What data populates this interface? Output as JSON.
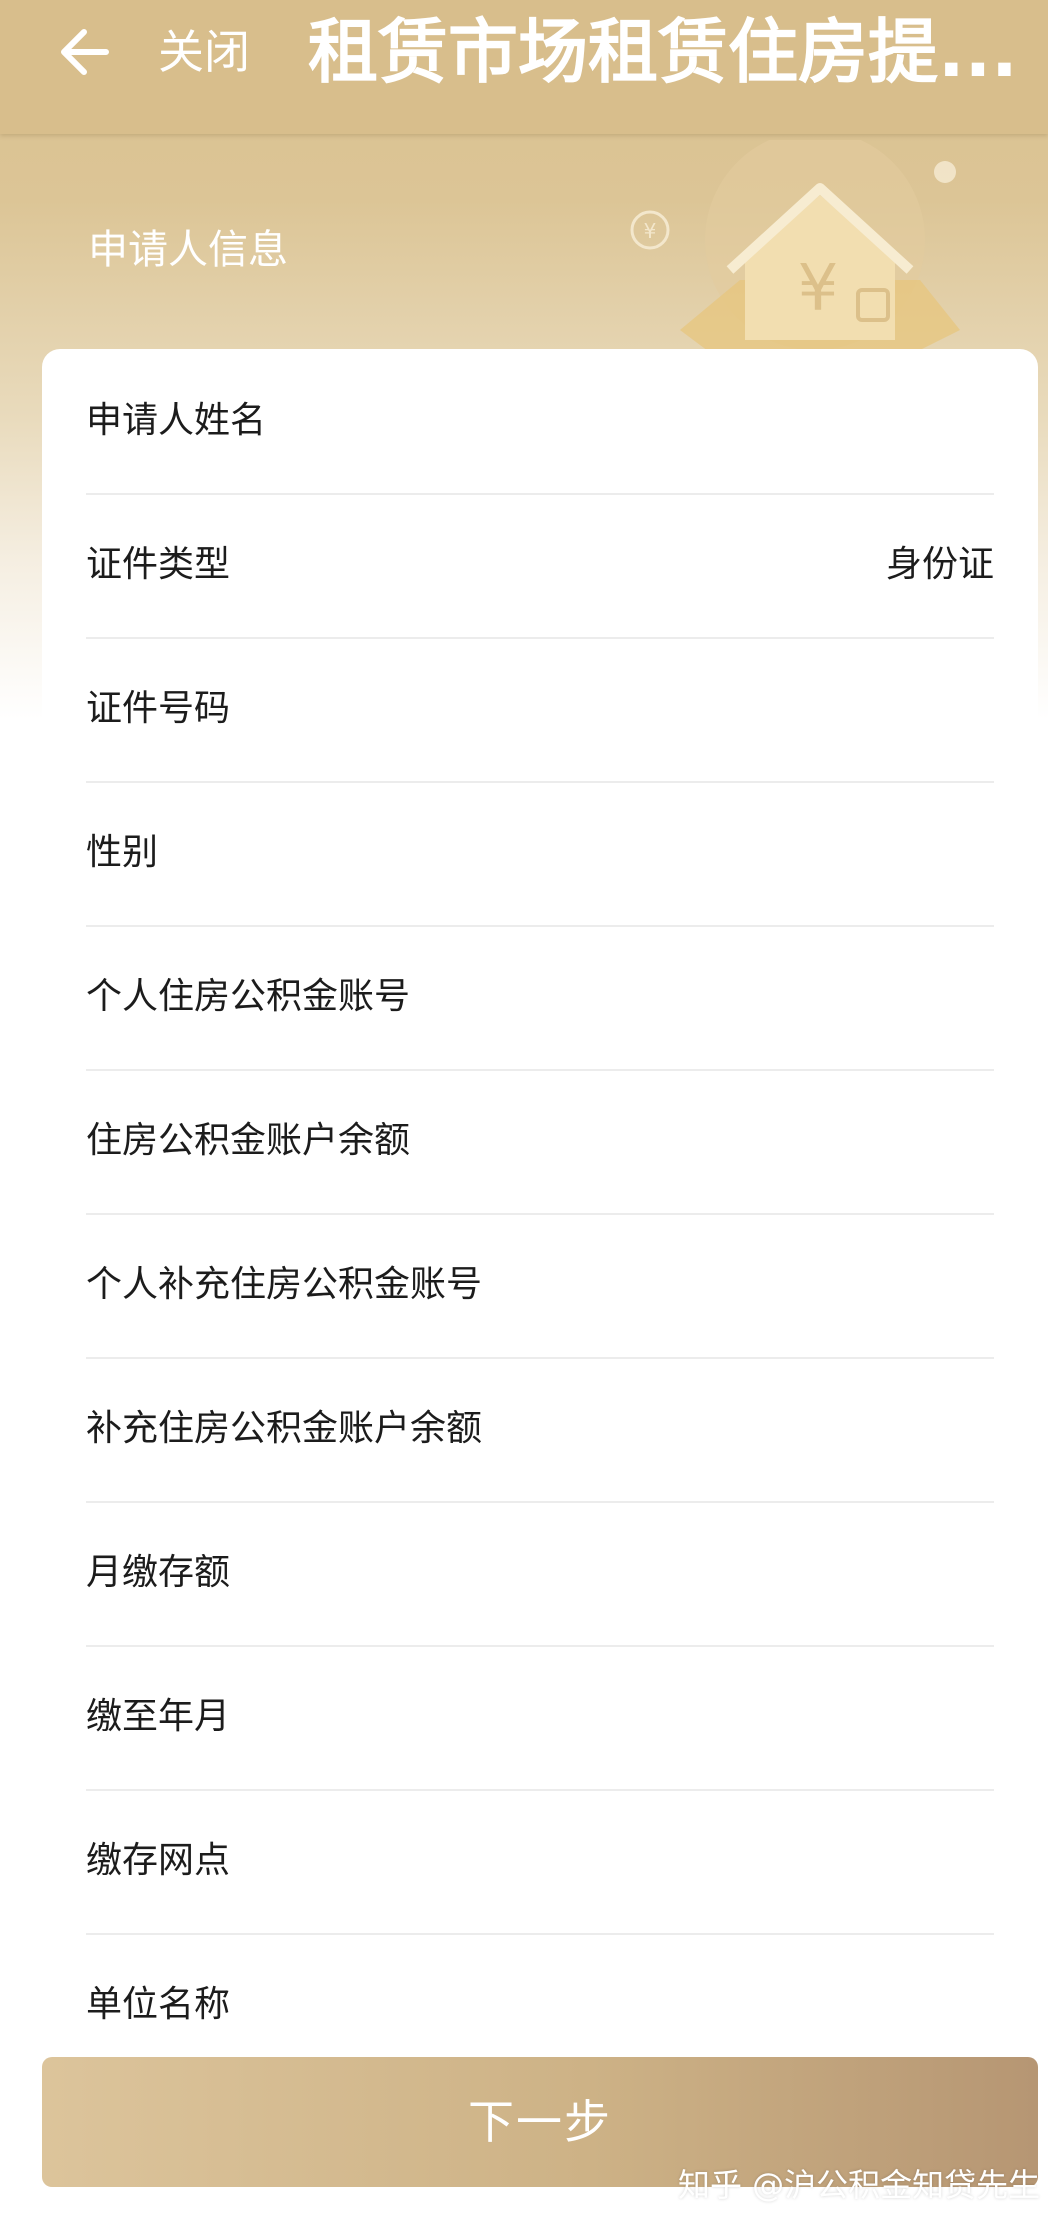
{
  "colors": {
    "header": "#d8be8c",
    "accent_gold": "#cdb286",
    "button_end": "#b69673",
    "text": "#1c1c1c",
    "divider": "#ececec"
  },
  "header": {
    "back_icon": "arrow-left-icon",
    "close_label": "关闭",
    "title": "租赁市场租赁住房提..."
  },
  "section": {
    "title": "申请人信息",
    "decoration_icon": "house-yuan-illustration"
  },
  "form": {
    "rows": [
      {
        "label": "申请人姓名",
        "value": ""
      },
      {
        "label": "证件类型",
        "value": "身份证"
      },
      {
        "label": "证件号码",
        "value": ""
      },
      {
        "label": "性别",
        "value": ""
      },
      {
        "label": "个人住房公积金账号",
        "value": ""
      },
      {
        "label": "住房公积金账户余额",
        "value": ""
      },
      {
        "label": "个人补充住房公积金账号",
        "value": ""
      },
      {
        "label": "补充住房公积金账户余额",
        "value": ""
      },
      {
        "label": "月缴存额",
        "value": ""
      },
      {
        "label": "缴至年月",
        "value": ""
      },
      {
        "label": "缴存网点",
        "value": ""
      },
      {
        "label": "单位名称",
        "value": ""
      }
    ]
  },
  "footer": {
    "next_label": "下一步",
    "watermark": "知乎 @沪公积金知贷先生"
  }
}
